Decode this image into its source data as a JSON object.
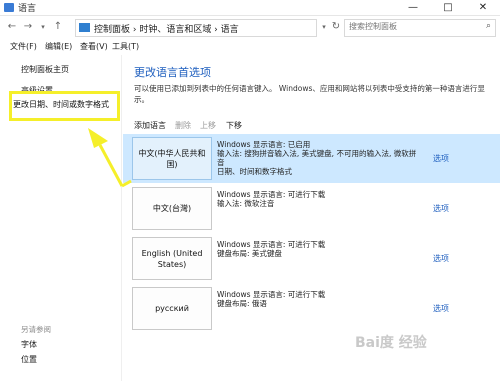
{
  "window": {
    "title": "语言",
    "minimize": "—",
    "maximize": "□",
    "close": "✕"
  },
  "address": {
    "path": "控制面板 › 时钟、语言和区域 › 语言",
    "search_placeholder": "搜索控制面板"
  },
  "menu": [
    "文件(F)",
    "编辑(E)",
    "查看(V)",
    "工具(T)"
  ],
  "sidebar": {
    "links": [
      "控制面板主页",
      "高级设置",
      "更改日期、时间或数字格式"
    ],
    "see_also_title": "另请参阅",
    "see_also": [
      "字体",
      "位置"
    ]
  },
  "main": {
    "heading": "更改语言首选项",
    "description": "可以使用已添加到列表中的任何语言键入。 Windows、应用和网站将以列表中受支持的第一种语言进行显示。",
    "toolbar": [
      "添加语言",
      "删除",
      "上移",
      "下移"
    ],
    "languages": [
      {
        "name": "中文(中华人民共和国)",
        "lines": [
          "Windows 显示语言: 已启用",
          "输入法: 搜狗拼音输入法, 美式键盘, 不可用的输入法, 微软拼音",
          "日期、时间和数字格式"
        ],
        "option": "选项"
      },
      {
        "name": "中文(台灣)",
        "lines": [
          "Windows 显示语言: 可进行下载",
          "输入法: 微软注音"
        ],
        "option": "选项"
      },
      {
        "name": "English (United States)",
        "lines": [
          "Windows 显示语言: 可进行下载",
          "键盘布局: 美式键盘"
        ],
        "option": "选项"
      },
      {
        "name": "русский",
        "lines": [
          "Windows 显示语言: 可进行下载",
          "键盘布局: 俄语"
        ],
        "option": "选项"
      }
    ]
  },
  "colors": {
    "accent": "#1f5fbf",
    "selected_row": "#cde8ff",
    "highlight": "#f5ef2a"
  },
  "watermark": "Bai度 经验"
}
